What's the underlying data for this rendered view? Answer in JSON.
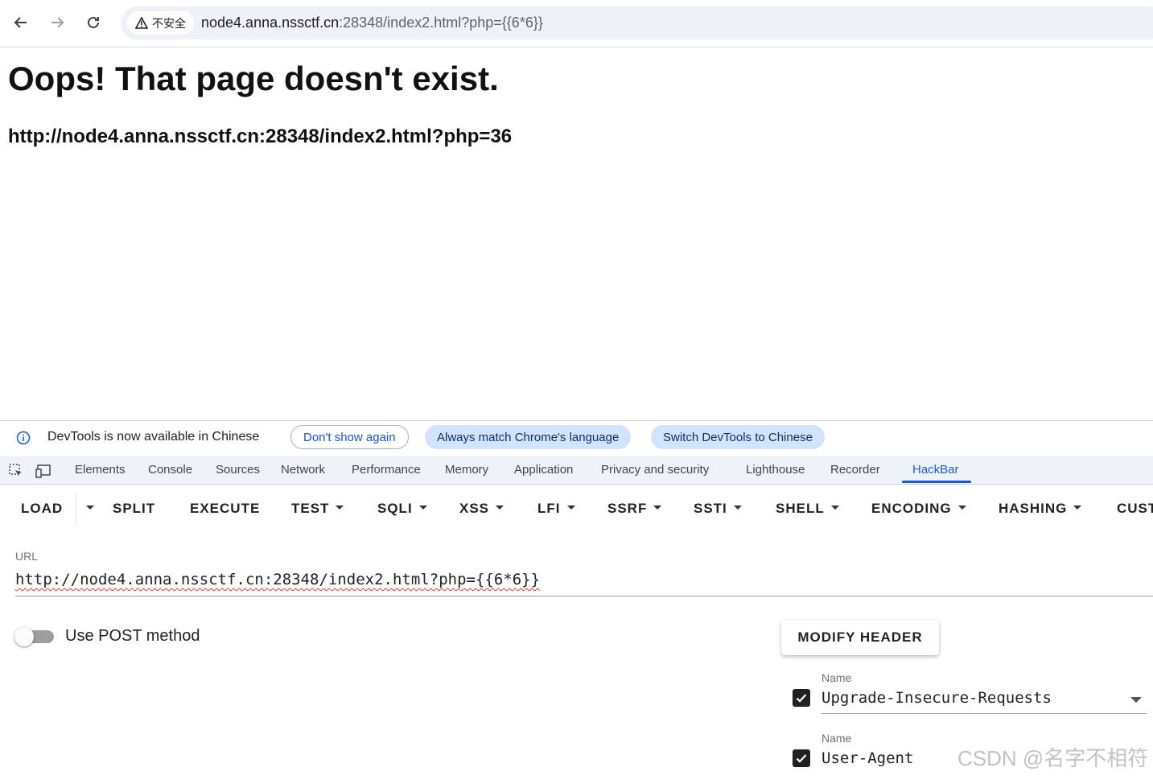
{
  "browser": {
    "security_label": "不安全",
    "url_host": "node4.anna.nssctf.cn",
    "url_path": ":28348/index2.html?php={{6*6}}"
  },
  "page": {
    "title": "Oops! That page doesn't exist.",
    "url_line": "http://node4.anna.nssctf.cn:28348/index2.html?php=36"
  },
  "devtools": {
    "infobar": {
      "message": "DevTools is now available in Chinese",
      "dont_show": "Don't show again",
      "match_language": "Always match Chrome's language",
      "switch_chinese": "Switch DevTools to Chinese"
    },
    "tabs": [
      "Elements",
      "Console",
      "Sources",
      "Network",
      "Performance",
      "Memory",
      "Application",
      "Privacy and security",
      "Lighthouse",
      "Recorder",
      "HackBar"
    ],
    "active_tab": "HackBar"
  },
  "hackbar": {
    "toolbar": [
      "LOAD",
      "SPLIT",
      "EXECUTE",
      "TEST",
      "SQLI",
      "XSS",
      "LFI",
      "SSRF",
      "SSTI",
      "SHELL",
      "ENCODING",
      "HASHING",
      "CUST"
    ],
    "url_label": "URL",
    "url_value": "http://node4.anna.nssctf.cn:28348/index2.html?php={{6*6}}",
    "post_label": "Use POST method",
    "post_enabled": false,
    "modify_header_label": "MODIFY HEADER",
    "headers": [
      {
        "label": "Name",
        "value": "Upgrade-Insecure-Requests",
        "checked": true
      },
      {
        "label": "Name",
        "value": "User-Agent",
        "checked": true
      }
    ]
  },
  "watermark": "CSDN @名字不相符"
}
